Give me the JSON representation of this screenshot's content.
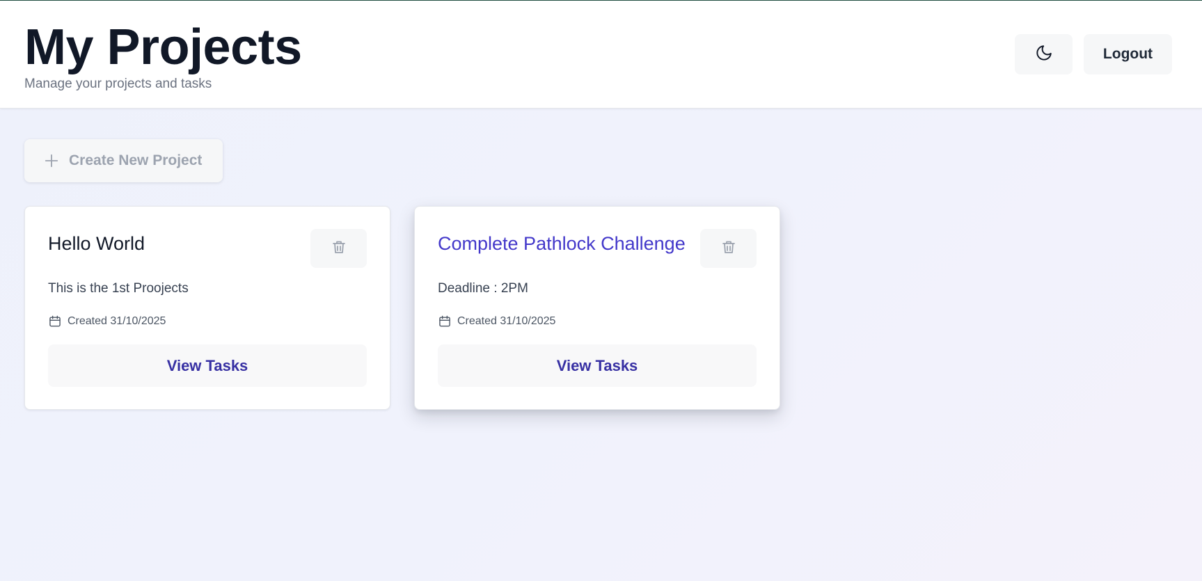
{
  "header": {
    "title": "My Projects",
    "subtitle": "Manage your projects and tasks",
    "theme_toggle_icon": "moon-icon",
    "logout_label": "Logout"
  },
  "toolbar": {
    "create_label": "Create New Project",
    "create_icon": "plus-icon"
  },
  "projects": [
    {
      "title": "Hello World",
      "description": "This is the 1st Proojects",
      "created": "Created 31/10/2025",
      "view_label": "View Tasks",
      "delete_icon": "trash-icon",
      "hovered": false
    },
    {
      "title": "Complete Pathlock Challenge",
      "description": "Deadline : 2PM",
      "created": "Created 31/10/2025",
      "view_label": "View Tasks",
      "delete_icon": "trash-icon",
      "hovered": true
    }
  ],
  "colors": {
    "accent": "#4338ca",
    "title": "#111827",
    "muted": "#6b7280",
    "button_bg": "#f6f7f8"
  }
}
